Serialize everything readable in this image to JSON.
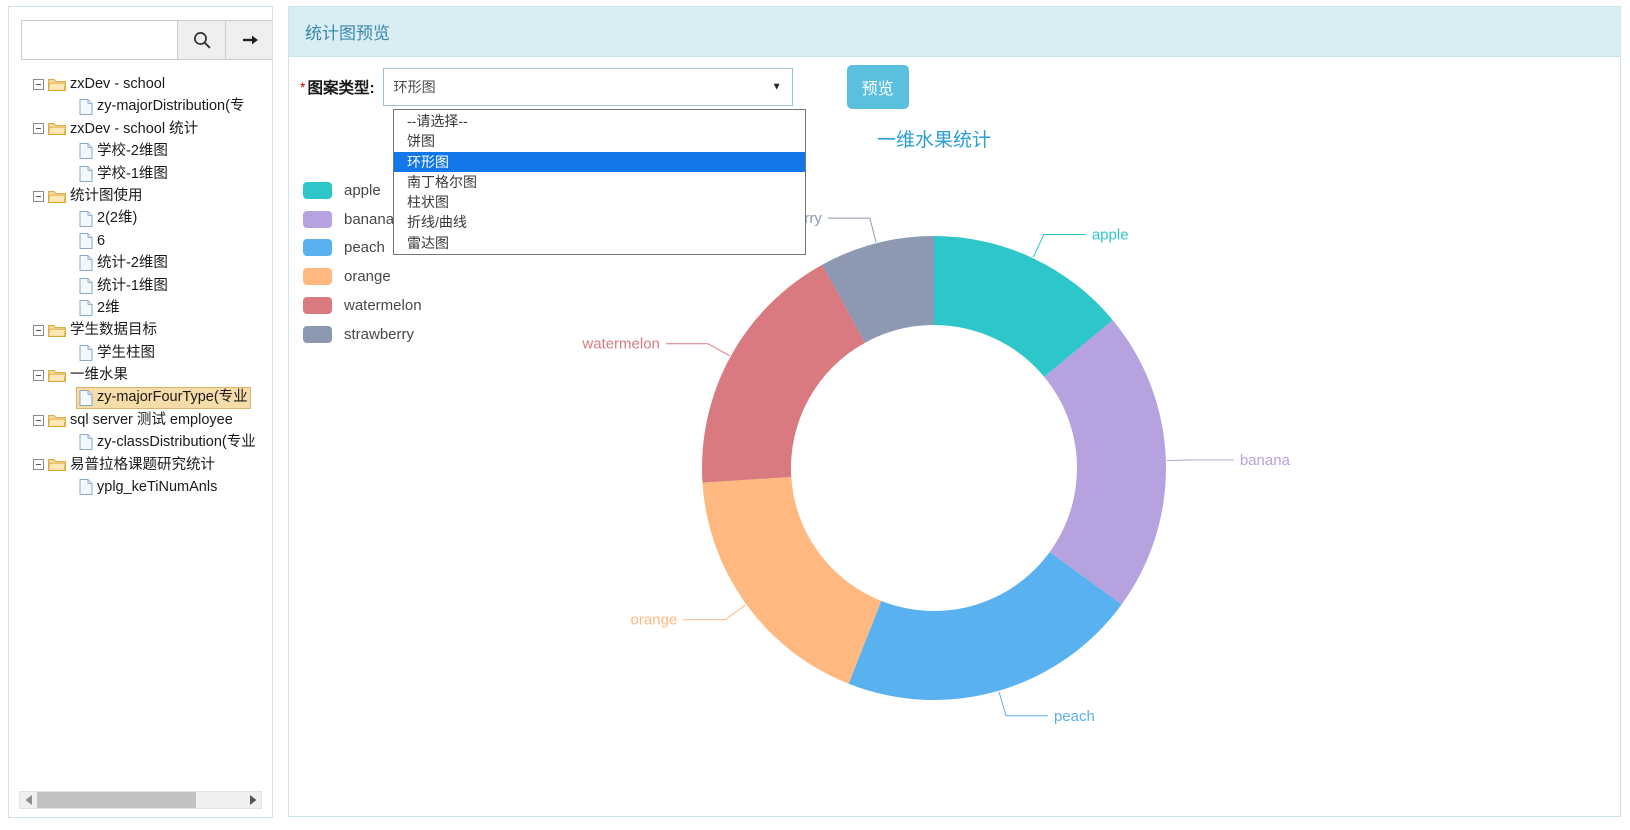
{
  "sidebar": {
    "search": {
      "value": "",
      "placeholder": ""
    },
    "search_icon_label": "search-icon",
    "go_icon_label": "arrow-right-icon",
    "tree": [
      {
        "label": "zxDev - school",
        "type": "folder",
        "level": 0,
        "selected": false
      },
      {
        "label": "zy-majorDistribution(专",
        "type": "file",
        "level": 1,
        "selected": false
      },
      {
        "label": " zxDev - school 统计",
        "type": "folder",
        "level": 0,
        "selected": false
      },
      {
        "label": "学校-2维图",
        "type": "file",
        "level": 1,
        "selected": false
      },
      {
        "label": "学校-1维图",
        "type": "file",
        "level": 1,
        "selected": false
      },
      {
        "label": "统计图使用",
        "type": "folder",
        "level": 0,
        "selected": false
      },
      {
        "label": "2(2维)",
        "type": "file",
        "level": 1,
        "selected": false
      },
      {
        "label": "6",
        "type": "file",
        "level": 1,
        "selected": false
      },
      {
        "label": "统计-2维图",
        "type": "file",
        "level": 1,
        "selected": false
      },
      {
        "label": "统计-1维图",
        "type": "file",
        "level": 1,
        "selected": false
      },
      {
        "label": "2维",
        "type": "file",
        "level": 1,
        "selected": false
      },
      {
        "label": "学生数据目标",
        "type": "folder",
        "level": 0,
        "selected": false
      },
      {
        "label": "学生柱图",
        "type": "file",
        "level": 1,
        "selected": false
      },
      {
        "label": "一维水果",
        "type": "folder",
        "level": 0,
        "selected": false
      },
      {
        "label": "zy-majorFourType(专业",
        "type": "file",
        "level": 1,
        "selected": true
      },
      {
        "label": "sql server 测试 employee",
        "type": "folder",
        "level": 0,
        "selected": false
      },
      {
        "label": "zy-classDistribution(专业",
        "type": "file",
        "level": 1,
        "selected": false
      },
      {
        "label": "易普拉格课题研究统计",
        "type": "folder",
        "level": 0,
        "selected": false
      },
      {
        "label": "yplg_keTiNumAnls",
        "type": "file",
        "level": 1,
        "selected": false
      }
    ],
    "scrollbar": {
      "left_arrow_label": "scroll-left-arrow",
      "right_arrow_label": "scroll-right-arrow"
    }
  },
  "content": {
    "header_title": "统计图预览",
    "form": {
      "required_mark": "*",
      "label": "图案类型:",
      "select_value": "环形图",
      "caret": "▼",
      "preview_button": "预览"
    },
    "dropdown": {
      "open": true,
      "options": [
        {
          "label": "--请选择--",
          "selected": false
        },
        {
          "label": "饼图",
          "selected": false
        },
        {
          "label": "环形图",
          "selected": true
        },
        {
          "label": "南丁格尔图",
          "selected": false
        },
        {
          "label": "柱状图",
          "selected": false
        },
        {
          "label": "折线/曲线",
          "selected": false
        },
        {
          "label": "雷达图",
          "selected": false
        }
      ]
    }
  },
  "chart_data": {
    "type": "pie",
    "variant": "donut",
    "title": "一维水果统计",
    "title_color": "#2a9fd6",
    "categories": [
      "apple",
      "banana",
      "peach",
      "orange",
      "watermelon",
      "strawberry"
    ],
    "values": [
      14,
      21,
      21,
      18,
      18,
      8
    ],
    "colors": [
      "#2ec7c9",
      "#b6a2de",
      "#5ab1ef",
      "#ffb980",
      "#d87a80",
      "#8d98b3"
    ],
    "legend": {
      "position": "left",
      "entries": [
        {
          "label": "apple",
          "color": "#2ec7c9"
        },
        {
          "label": "banana",
          "color": "#b6a2de"
        },
        {
          "label": "peach",
          "color": "#5ab1ef"
        },
        {
          "label": "orange",
          "color": "#ffb980"
        },
        {
          "label": "watermelon",
          "color": "#d87a80"
        },
        {
          "label": "strawberry",
          "color": "#8d98b3"
        }
      ]
    },
    "labels": [
      {
        "text": "apple",
        "color": "#2ec7c9"
      },
      {
        "text": "banana",
        "color": "#b6a2de"
      },
      {
        "text": "peach",
        "color": "#5ab1ef"
      },
      {
        "text": "orange",
        "color": "#ffb980"
      },
      {
        "text": "watermelon",
        "color": "#d87a80"
      },
      {
        "text": "strawberry",
        "color": "#8d98b3"
      }
    ],
    "grid": false
  }
}
